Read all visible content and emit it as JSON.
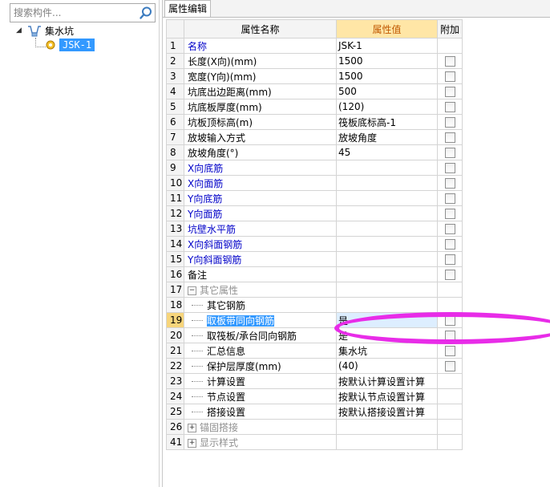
{
  "left": {
    "search_placeholder": "搜索构件...",
    "tree": {
      "root_label": "集水坑",
      "child_label": "JSK-1"
    }
  },
  "right": {
    "tab": "属性编辑",
    "headers": {
      "name": "属性名称",
      "value": "属性值",
      "add": "附加"
    },
    "rows": [
      {
        "n": "1",
        "name": "名称",
        "value": "JSK-1",
        "cb": false,
        "style": "blue"
      },
      {
        "n": "2",
        "name": "长度(X向)(mm)",
        "value": "1500",
        "cb": true
      },
      {
        "n": "3",
        "name": "宽度(Y向)(mm)",
        "value": "1500",
        "cb": true
      },
      {
        "n": "4",
        "name": "坑底出边距离(mm)",
        "value": "500",
        "cb": true
      },
      {
        "n": "5",
        "name": "坑底板厚度(mm)",
        "value": "(120)",
        "cb": true
      },
      {
        "n": "6",
        "name": "坑板顶标高(m)",
        "value": "筏板底标高-1",
        "cb": true
      },
      {
        "n": "7",
        "name": "放坡输入方式",
        "value": "放坡角度",
        "cb": true
      },
      {
        "n": "8",
        "name": "放坡角度(°)",
        "value": "45",
        "cb": true
      },
      {
        "n": "9",
        "name": "X向底筋",
        "value": "",
        "cb": true,
        "style": "blue"
      },
      {
        "n": "10",
        "name": "X向面筋",
        "value": "",
        "cb": true,
        "style": "blue"
      },
      {
        "n": "11",
        "name": "Y向底筋",
        "value": "",
        "cb": true,
        "style": "blue"
      },
      {
        "n": "12",
        "name": "Y向面筋",
        "value": "",
        "cb": true,
        "style": "blue"
      },
      {
        "n": "13",
        "name": "坑壁水平筋",
        "value": "",
        "cb": true,
        "style": "blue"
      },
      {
        "n": "14",
        "name": "X向斜面钢筋",
        "value": "",
        "cb": true,
        "style": "blue"
      },
      {
        "n": "15",
        "name": "Y向斜面钢筋",
        "value": "",
        "cb": true,
        "style": "blue"
      },
      {
        "n": "16",
        "name": "备注",
        "value": "",
        "cb": true
      },
      {
        "n": "17",
        "name": "其它属性",
        "value": "",
        "cb": false,
        "style": "gray",
        "toggle": "minus"
      },
      {
        "n": "18",
        "name": "其它钢筋",
        "value": "",
        "cb": false,
        "child": true
      },
      {
        "n": "19",
        "name": "取板带同向钢筋",
        "value": "是",
        "cb": true,
        "child": true,
        "selected": true
      },
      {
        "n": "20",
        "name": "取筏板/承台同向钢筋",
        "value": "是",
        "cb": true,
        "child": true
      },
      {
        "n": "21",
        "name": "汇总信息",
        "value": "集水坑",
        "cb": true,
        "child": true
      },
      {
        "n": "22",
        "name": "保护层厚度(mm)",
        "value": "(40)",
        "cb": true,
        "child": true
      },
      {
        "n": "23",
        "name": "计算设置",
        "value": "按默认计算设置计算",
        "cb": false,
        "child": true
      },
      {
        "n": "24",
        "name": "节点设置",
        "value": "按默认节点设置计算",
        "cb": false,
        "child": true
      },
      {
        "n": "25",
        "name": "搭接设置",
        "value": "按默认搭接设置计算",
        "cb": false,
        "child": true
      },
      {
        "n": "26",
        "name": "锚固搭接",
        "value": "",
        "cb": false,
        "style": "gray",
        "toggle": "plus"
      },
      {
        "n": "41",
        "name": "显示样式",
        "value": "",
        "cb": false,
        "style": "gray",
        "toggle": "plus"
      }
    ]
  },
  "colors": {
    "selection": "#3399ff",
    "annotation": "#e82ce8",
    "value_header": "#ffe6a6"
  }
}
